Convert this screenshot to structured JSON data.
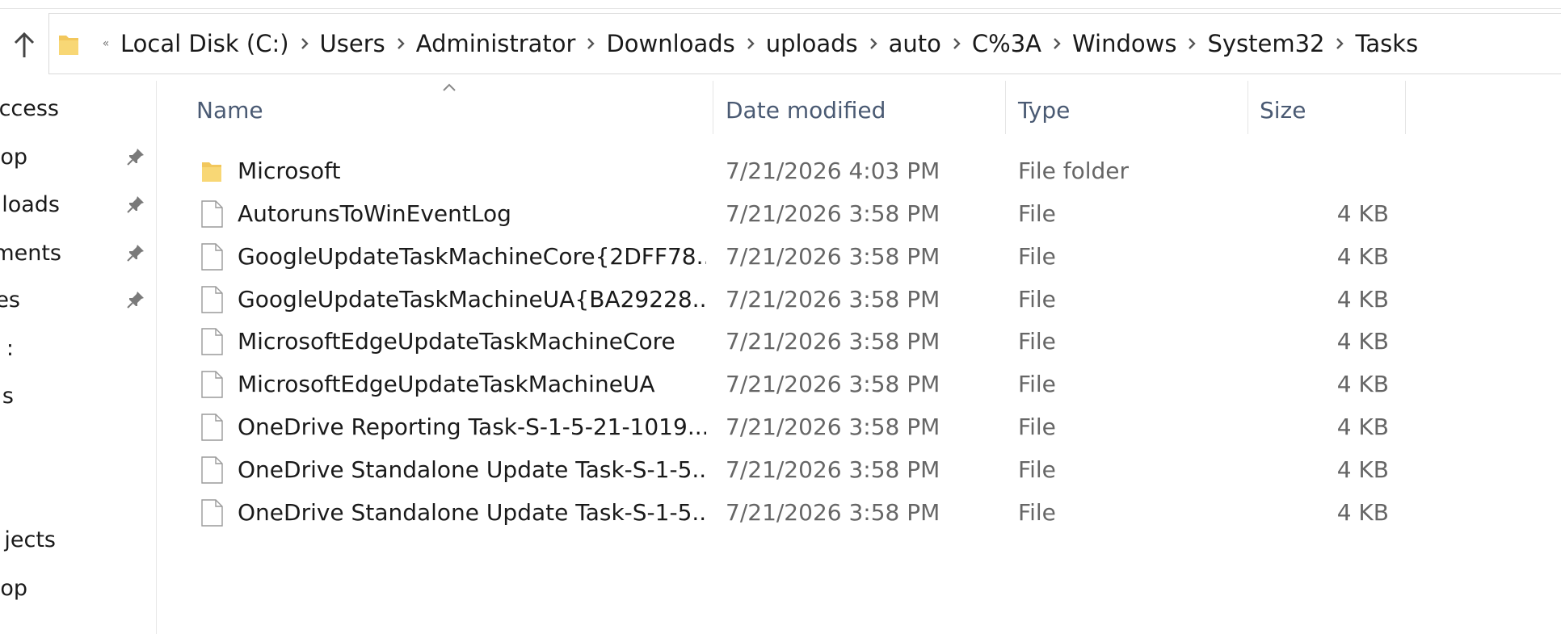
{
  "address_bar": {
    "overflow_glyph": "«",
    "crumbs": [
      "Local Disk (C:)",
      "Users",
      "Administrator",
      "Downloads",
      "uploads",
      "auto",
      "C%3A",
      "Windows",
      "System32",
      "Tasks"
    ]
  },
  "sidebar": {
    "items": [
      {
        "label": "ccess",
        "pinned": false
      },
      {
        "label": "op",
        "pinned": true
      },
      {
        "label": "loads",
        "pinned": true
      },
      {
        "label": "ments",
        "pinned": true
      },
      {
        "label": "es",
        "pinned": true
      },
      {
        "label": ":",
        "pinned": false
      },
      {
        "label": "s",
        "pinned": false
      },
      {
        "label": "jects",
        "pinned": false
      },
      {
        "label": "op",
        "pinned": false
      }
    ]
  },
  "columns": {
    "name": "Name",
    "date": "Date modified",
    "type": "Type",
    "size": "Size"
  },
  "files": [
    {
      "name": "Microsoft",
      "date": "7/21/2026 4:03 PM",
      "type": "File folder",
      "size": "",
      "icon": "folder-icon"
    },
    {
      "name": "AutorunsToWinEventLog",
      "date": "7/21/2026 3:58 PM",
      "type": "File",
      "size": "4 KB",
      "icon": "file-icon"
    },
    {
      "name": "GoogleUpdateTaskMachineCore{2DFF78...",
      "date": "7/21/2026 3:58 PM",
      "type": "File",
      "size": "4 KB",
      "icon": "file-icon"
    },
    {
      "name": "GoogleUpdateTaskMachineUA{BA29228...",
      "date": "7/21/2026 3:58 PM",
      "type": "File",
      "size": "4 KB",
      "icon": "file-icon"
    },
    {
      "name": "MicrosoftEdgeUpdateTaskMachineCore",
      "date": "7/21/2026 3:58 PM",
      "type": "File",
      "size": "4 KB",
      "icon": "file-icon"
    },
    {
      "name": "MicrosoftEdgeUpdateTaskMachineUA",
      "date": "7/21/2026 3:58 PM",
      "type": "File",
      "size": "4 KB",
      "icon": "file-icon"
    },
    {
      "name": "OneDrive Reporting Task-S-1-5-21-1019...",
      "date": "7/21/2026 3:58 PM",
      "type": "File",
      "size": "4 KB",
      "icon": "file-icon"
    },
    {
      "name": "OneDrive Standalone Update Task-S-1-5...",
      "date": "7/21/2026 3:58 PM",
      "type": "File",
      "size": "4 KB",
      "icon": "file-icon"
    },
    {
      "name": "OneDrive Standalone Update Task-S-1-5...",
      "date": "7/21/2026 3:58 PM",
      "type": "File",
      "size": "4 KB",
      "icon": "file-icon"
    }
  ],
  "colors": {
    "folder": "#f2c75c",
    "header_text": "#4a5a73",
    "border": "#d9d9d9"
  }
}
